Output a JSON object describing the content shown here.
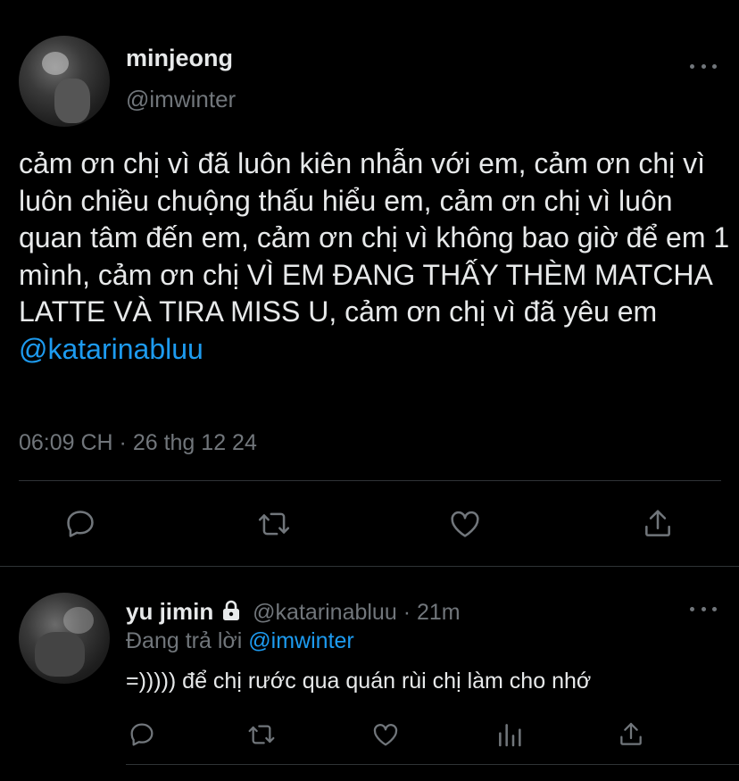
{
  "main_tweet": {
    "author_name": "minjeong",
    "author_handle": "@imwinter",
    "text": "cảm ơn chị vì đã luôn kiên nhẫn với em, cảm ơn chị vì luôn chiều chuộng thấu hiểu em, cảm ơn chị vì luôn quan tâm đến em, cảm ơn chị vì không bao giờ để em 1 mình, cảm ơn chị VÌ EM ĐANG THẤY THÈM MATCHA LATTE VÀ TIRA MISS U, cảm ơn chị vì đã yêu em",
    "mention": "@katarinabluu",
    "timestamp": "06:09 CH · 26 thg 12 24",
    "actions": [
      "reply-icon",
      "retweet-icon",
      "like-icon",
      "share-icon"
    ]
  },
  "reply": {
    "author_name": "yu jimin",
    "locked": true,
    "author_handle": "@katarinabluu",
    "time_sep": "·",
    "time": "21m",
    "replying_prefix": "Đang trả lời",
    "replying_to": "@imwinter",
    "text": "=))))) để chị rước qua quán rùi chị làm cho nhớ",
    "actions": [
      "reply-icon",
      "retweet-icon",
      "like-icon",
      "analytics-icon",
      "share-icon"
    ]
  },
  "colors": {
    "background": "#000000",
    "text": "#e7e9ea",
    "secondary": "#71767b",
    "accent": "#1d9bf0",
    "divider": "#2f3336"
  }
}
